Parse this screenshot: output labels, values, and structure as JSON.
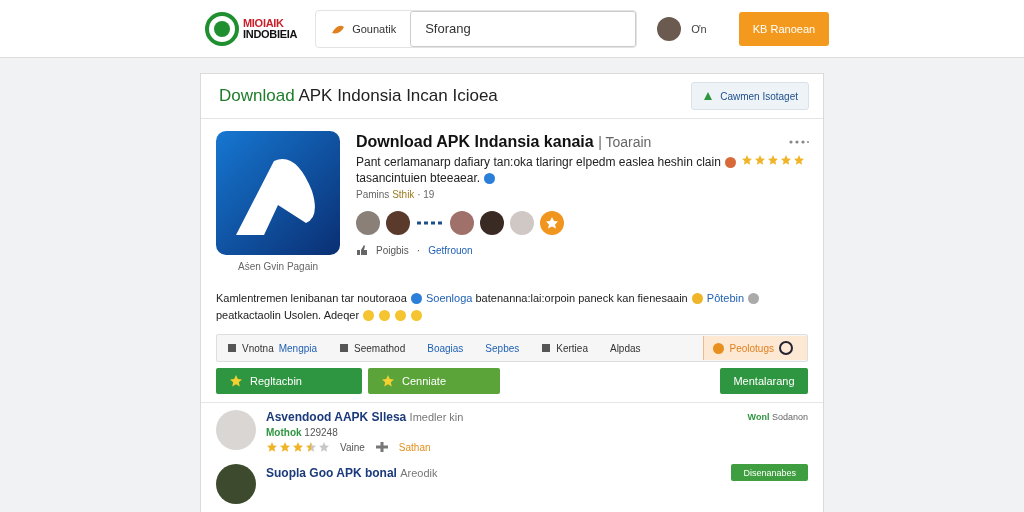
{
  "header": {
    "logo_top": "MIOIAIK",
    "logo_bottom": "INDOBIEIA",
    "search_scope": "Gounatik",
    "search_value": "Sforang",
    "user_name": "Ơn",
    "action_button": "KB Ranoean"
  },
  "card": {
    "title_accent": "Download",
    "title_rest": "APK Indonsia Incan Icioea",
    "header_button": "Cawmen Isotaget",
    "app": {
      "caption": "Aṡen Gvin Pagain",
      "title": "Download APK Indansia kanaia",
      "title_suffix": "| Toarain",
      "description": "Pant cerlamanarp dafiary tan:oka tlaringr elpedm easlea heshin clain",
      "stars": 5,
      "description_end": "tasancintuien bteeaear.",
      "meta_label": "Pamins",
      "meta_value": "Sthik",
      "meta_count": "· 19",
      "like_label": "Poigbis",
      "separator": "·",
      "link": "Getfrouon"
    },
    "paragraph": {
      "part1": "Kamlentremen lenibanan tar noutoraoa",
      "link1": "Soenloga",
      "part2": "batenanna:lai:orpoin paneck  kan  fienesaain",
      "link2": "Pôtebin",
      "line2": "peatkactaolin Usolen. Adeqer"
    },
    "filters": [
      {
        "kind": "icon",
        "label": "Vnotna",
        "accent": "Mengpia",
        "selected": false
      },
      {
        "kind": "icon",
        "label": "Seemathod",
        "selected": false
      },
      {
        "kind": "link",
        "label": "Boagias",
        "selected": false
      },
      {
        "kind": "link",
        "label": "Sepbes",
        "selected": false
      },
      {
        "kind": "icon",
        "label": "Kertiea",
        "selected": false
      },
      {
        "kind": "plain",
        "label": "Alpdas",
        "selected": false
      },
      {
        "kind": "chip",
        "label": "Peolotugs",
        "selected": true
      }
    ],
    "buttons": [
      {
        "kind": "primary",
        "label": "Regltacbin"
      },
      {
        "kind": "secondary",
        "label": "Cenniate"
      },
      {
        "kind": "primary",
        "label": "Mentalarang"
      }
    ],
    "reviews": [
      {
        "name": "Asvendood AAPK Sllesa",
        "tag": "Imedler  kin",
        "status_label": "Mothok",
        "status_value": "129248",
        "stars": 3.5,
        "action": "Vaine",
        "reply": "Sathan",
        "badge_accent": "Wonl",
        "badge_text": "Sodanon",
        "kind": "text"
      },
      {
        "name": "Suopla Goo APK bonal",
        "tag": "Areodik",
        "kind": "button",
        "badge_text": "Disenanabes"
      }
    ]
  }
}
